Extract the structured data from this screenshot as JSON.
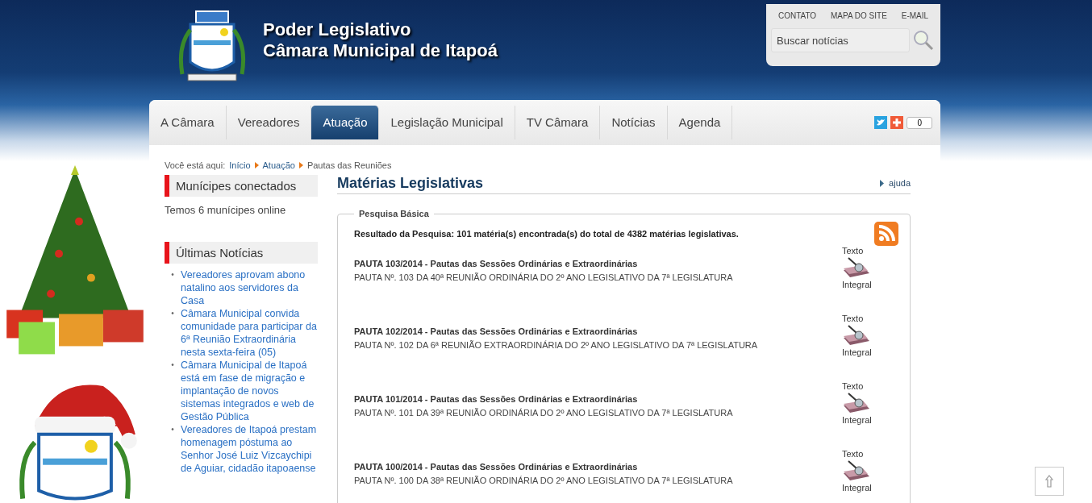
{
  "header": {
    "title_line1": "Poder Legislativo",
    "title_line2": "Câmara Municipal de Itapoá"
  },
  "top_links": [
    "CONTATO",
    "MAPA DO SITE",
    "E-MAIL"
  ],
  "search": {
    "placeholder": "Buscar notícias"
  },
  "nav_tabs": [
    {
      "label": "A Câmara",
      "selected": false
    },
    {
      "label": "Vereadores",
      "selected": false
    },
    {
      "label": "Atuação",
      "selected": true
    },
    {
      "label": "Legislação Municipal",
      "selected": false
    },
    {
      "label": "TV Câmara",
      "selected": false
    },
    {
      "label": "Notícias",
      "selected": false
    },
    {
      "label": "Agenda",
      "selected": false
    }
  ],
  "share_count": "0",
  "breadcrumb": {
    "label": "Você está aqui:",
    "items": [
      "Início",
      "Atuação",
      "Pautas das Reuniões"
    ]
  },
  "sidebar": [
    {
      "title": "Munícipes conectados",
      "text": "Temos 6 munícipes online"
    },
    {
      "title": "Últimas Notícias",
      "bullet": "•",
      "links": [
        "Vereadores aprovam abono natalino aos servidores da Casa",
        "Câmara Municipal convida comunidade para participar da 6ª Reunião Extraordinária nesta sexta-feira (05)",
        "Câmara Municipal de Itapoá está em fase de migração e implantação de novos sistemas integrados e web de Gestão Pública",
        "Vereadores de Itapoá prestam homenagem póstuma ao Senhor José Luiz Vizcaychipi de Aguiar, cidadão itapoaense"
      ]
    }
  ],
  "main": {
    "title": "Matérias Legislativas",
    "help": "ajuda",
    "legend": "Pesquisa Básica",
    "result": "Resultado da Pesquisa: 101 matéria(s) encontrada(s) do total de  4382 matérias legislativas.",
    "items": [
      {
        "title": "PAUTA 103/2014 - Pautas das Sessões Ordinárias e Extraordinárias",
        "description": "PAUTA Nº. 103 DA 40ª REUNIÃO ORDINÁRIA DO 2º ANO LEGISLATIVO DA 7ª LEGISLATURA",
        "link_top": "Texto",
        "link_bottom": "Integral"
      },
      {
        "title": "PAUTA 102/2014 - Pautas das Sessões Ordinárias e Extraordinárias",
        "description": "PAUTA Nº. 102 DA 6ª REUNIÃO EXTRAORDINÁRIA DO 2º ANO LEGISLATIVO DA 7ª LEGISLATURA",
        "link_top": "Texto",
        "link_bottom": "Integral"
      },
      {
        "title": "PAUTA 101/2014 - Pautas das Sessões Ordinárias e Extraordinárias",
        "description": "PAUTA Nº. 101 DA 39ª REUNIÃO ORDINÁRIA DO 2º ANO LEGISLATIVO DA 7ª LEGISLATURA",
        "link_top": "Texto",
        "link_bottom": "Integral"
      },
      {
        "title": "PAUTA 100/2014 - Pautas das Sessões Ordinárias e Extraordinárias",
        "description": "PAUTA Nº. 100 DA 38ª REUNIÃO ORDINÁRIA DO 2º ANO LEGISLATIVO DA 7ª LEGISLATURA",
        "link_top": "Texto",
        "link_bottom": "Integral"
      }
    ]
  }
}
